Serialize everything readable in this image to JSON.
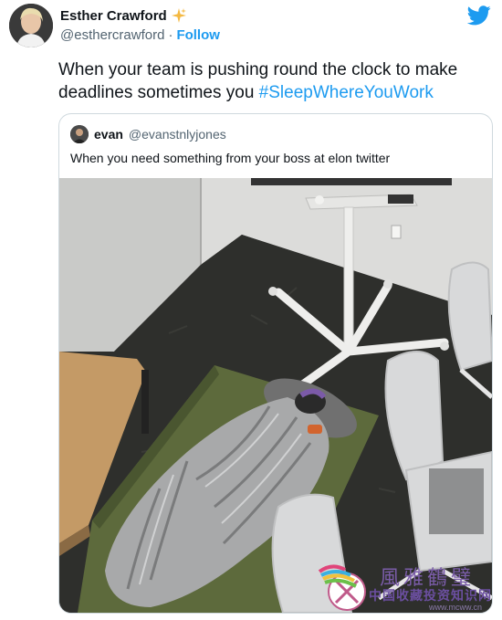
{
  "author": {
    "name": "Esther Crawford",
    "badge_icon": "sparkle-icon",
    "handle": "@esthercrawford",
    "separator": "·",
    "follow_label": "Follow"
  },
  "tweet": {
    "text_before": "When your team is pushing round the clock to make deadlines sometimes you ",
    "hashtag": "#SleepWhereYouWork"
  },
  "quoted": {
    "name": "evan",
    "handle": "@evanstnlyjones",
    "text": "When you need something from your boss at elon twitter"
  },
  "watermark": {
    "title": "風雅鶴璧",
    "subtitle": "中国收藏投资知识网",
    "url": "www.mcww.cn"
  },
  "colors": {
    "accent": "#1d9bf0",
    "text": "#0f1419",
    "muted": "#536471",
    "border": "#cfd9de"
  }
}
